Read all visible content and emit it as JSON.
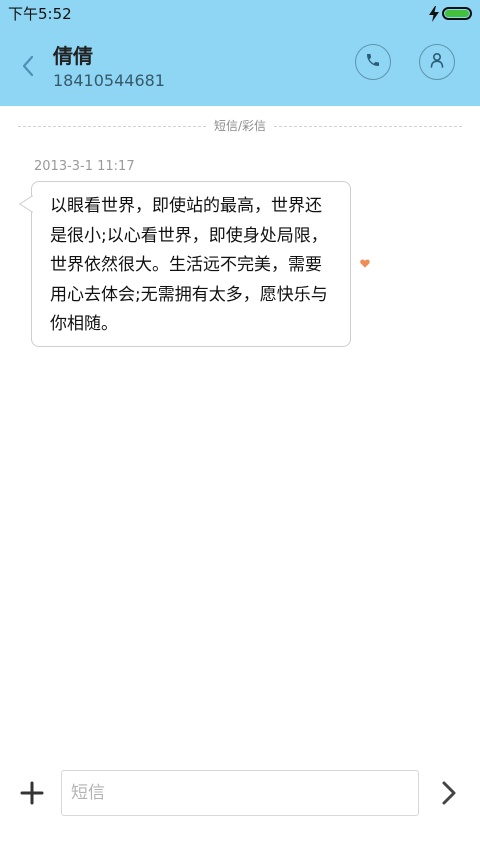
{
  "status_bar": {
    "time": "下午5:52",
    "charging_icon": "charging-bolt-icon",
    "battery_icon": "battery-full-icon",
    "battery_level": 1.0,
    "battery_color": "#43c13d"
  },
  "header": {
    "background_color": "#8fd6f5",
    "back_icon": "chevron-left-icon",
    "contact_name": "倩倩",
    "contact_number": "18410544681",
    "call_icon": "phone-icon",
    "contact_icon": "person-icon"
  },
  "conversation": {
    "divider_label": "短信/彩信",
    "messages": [
      {
        "timestamp": "2013-3-1 11:17",
        "text": "以眼看世界，即使站的最高，世界还是很小;以心看世界，即使身处局限，世界依然很大。生活远不完美，需要用心去体会;无需拥有太多，愿快乐与你相随。",
        "favorite_icon": "heart-icon",
        "favorite_color": "#f08c55"
      }
    ]
  },
  "composer": {
    "add_icon": "plus-icon",
    "input_placeholder": "短信",
    "input_value": "",
    "send_icon": "chevron-right-icon"
  }
}
